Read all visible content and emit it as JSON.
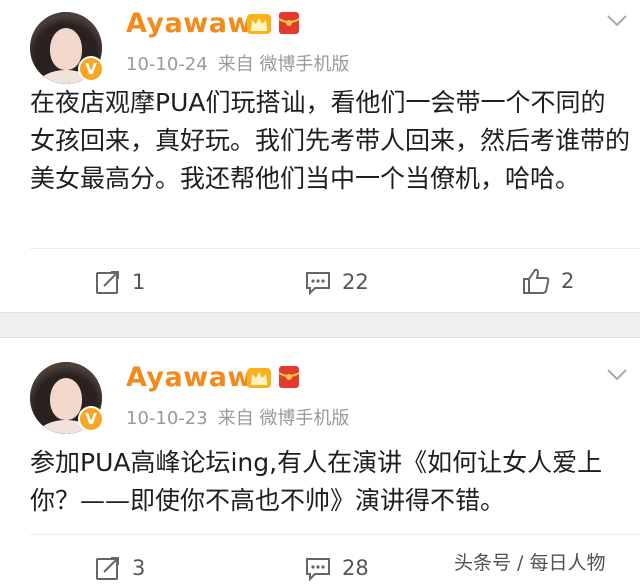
{
  "posts": [
    {
      "username": "Ayawawa",
      "time": "10-10-24",
      "source": "来自 微博手机版",
      "content": "在夜店观摩PUA们玩搭讪，看他们一会带一个不同的女孩回来，真好玩。我们先考带人回来，然后考谁带的美女最高分。我还帮他们当中一个当僚机，哈哈。",
      "repost_count": "1",
      "comment_count": "22",
      "like_count": "2"
    },
    {
      "username": "Ayawawa",
      "time": "10-10-23",
      "source": "来自 微博手机版",
      "content": "参加PUA高峰论坛ing,有人在演讲《如何让女人爱上你？——即使你不高也不帅》演讲得不错。",
      "repost_count": "3",
      "comment_count": "28"
    }
  ],
  "verified_badge": "V",
  "watermark": "头条号 / 每日人物",
  "colors": {
    "username": "#f28a1c",
    "meta": "#9a9a9a",
    "separator": "#efefef",
    "badge": "#f5a623"
  },
  "icons": [
    "verified-badge-icon",
    "crown-icon",
    "red-envelope-icon",
    "chevron-down-icon",
    "repost-icon",
    "comment-icon",
    "like-icon"
  ]
}
